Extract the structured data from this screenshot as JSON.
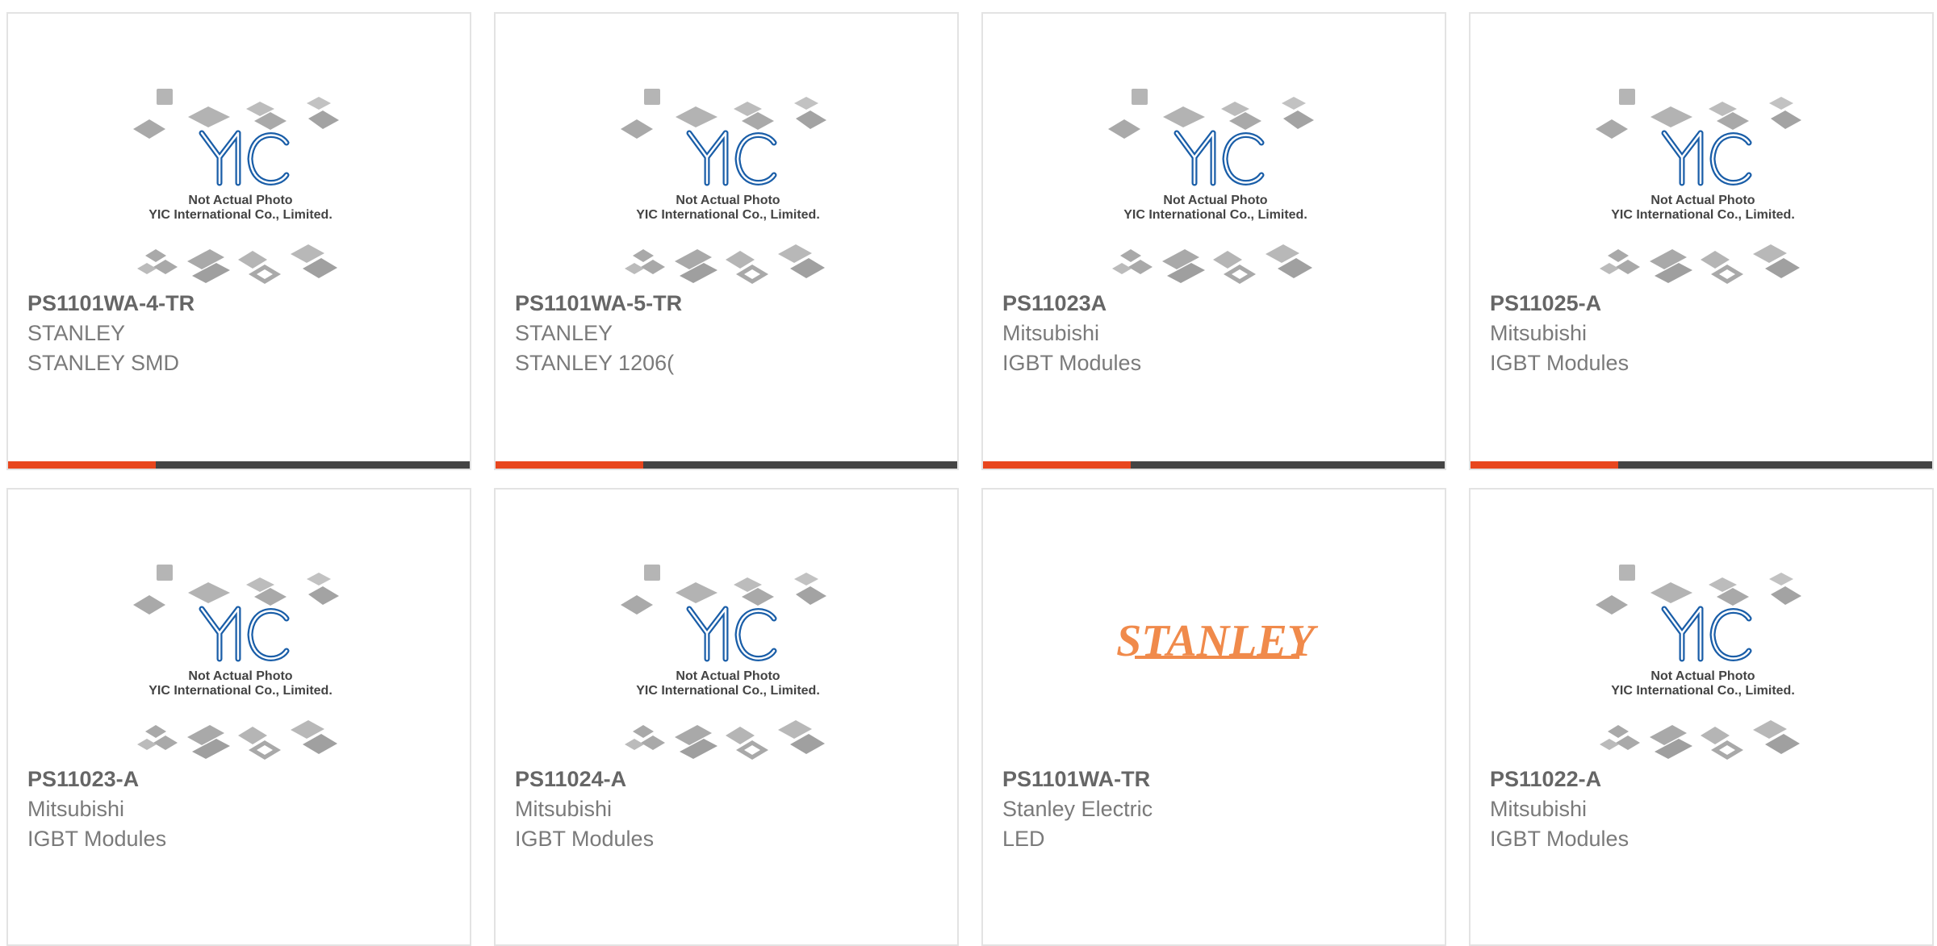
{
  "theme": {
    "accent_color": "#e8461e",
    "bar_color": "#444444",
    "logo_color": "#1a5ea8",
    "stanley_color": "#f08a4b"
  },
  "placeholder": {
    "line1": "Not Actual Photo",
    "line2": "YIC International Co., Limited.",
    "logo_text": "YIC"
  },
  "stanley_logo": {
    "text": "STANLEY"
  },
  "products": [
    {
      "part_number": "PS1101WA-4-TR",
      "manufacturer": "STANLEY",
      "description": "STANLEY SMD",
      "image": "yic-placeholder",
      "bar": true
    },
    {
      "part_number": "PS1101WA-5-TR",
      "manufacturer": "STANLEY",
      "description": "STANLEY 1206(",
      "image": "yic-placeholder",
      "bar": true
    },
    {
      "part_number": "PS11023A",
      "manufacturer": "Mitsubishi",
      "description": "IGBT Modules",
      "image": "yic-placeholder",
      "bar": true
    },
    {
      "part_number": "PS11025-A",
      "manufacturer": "Mitsubishi",
      "description": "IGBT Modules",
      "image": "yic-placeholder",
      "bar": true
    },
    {
      "part_number": "PS11023-A",
      "manufacturer": "Mitsubishi",
      "description": "IGBT Modules",
      "image": "yic-placeholder",
      "bar": false
    },
    {
      "part_number": "PS11024-A",
      "manufacturer": "Mitsubishi",
      "description": "IGBT Modules",
      "image": "yic-placeholder",
      "bar": false
    },
    {
      "part_number": "PS1101WA-TR",
      "manufacturer": "Stanley Electric",
      "description": "LED",
      "image": "stanley-logo",
      "bar": false
    },
    {
      "part_number": "PS11022-A",
      "manufacturer": "Mitsubishi",
      "description": "IGBT Modules",
      "image": "yic-placeholder",
      "bar": false
    }
  ]
}
